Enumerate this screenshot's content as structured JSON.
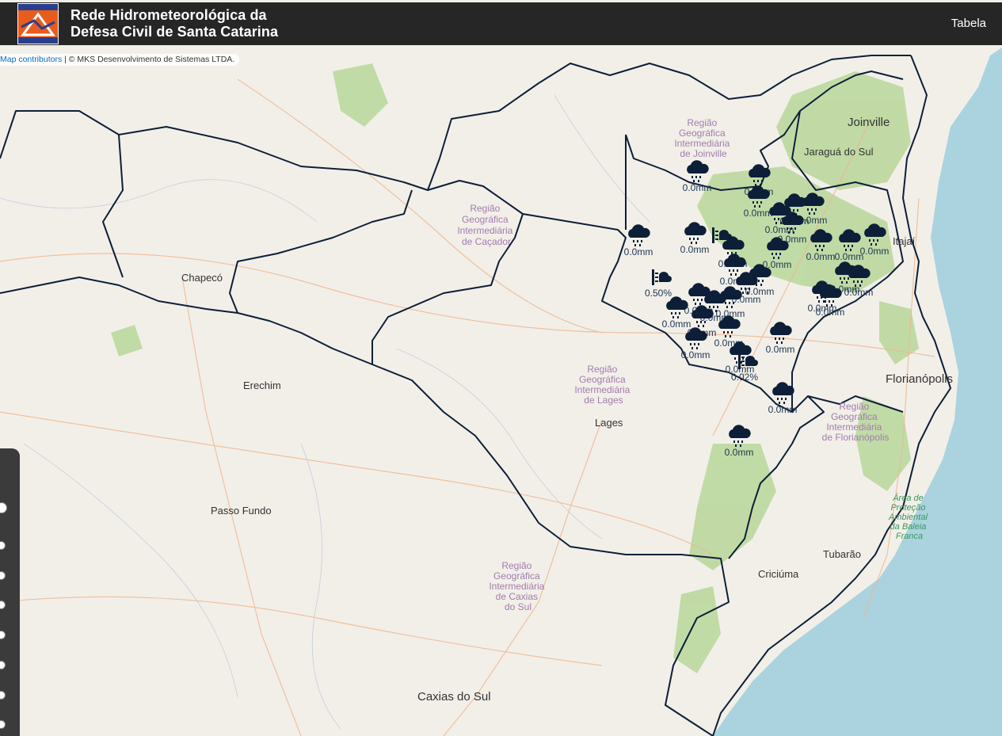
{
  "header": {
    "title_line1": "Rede Hidrometeorológica da",
    "title_line2": "Defesa Civil de Santa Catarina",
    "logo_text": "SANTA CATARINA",
    "table_link": "Tabela"
  },
  "attribution": {
    "link": "Map contributors",
    "text": " | © MKS Desenvolvimento de Sistemas LTDA."
  },
  "colors": {
    "topbar": "#262626",
    "border": "#0d1f38",
    "marker": "#0d1f38",
    "ocean": "#aad3df",
    "land": "#f2efe9",
    "forest": "#b9d79a"
  },
  "places": [
    {
      "name": "Joinville"
    },
    {
      "name": "Jaraguá do Sul"
    },
    {
      "name": "Chapecó"
    },
    {
      "name": "Erechim"
    },
    {
      "name": "Lages"
    },
    {
      "name": "Florianópolis"
    },
    {
      "name": "Passo Fundo"
    },
    {
      "name": "Tubarão"
    },
    {
      "name": "Criciúma"
    },
    {
      "name": "Caxias do Sul"
    },
    {
      "name": "Itajaí"
    }
  ],
  "regions": [
    {
      "lines": [
        "Região",
        "Geográfica",
        "Intermediária",
        "de Joinville"
      ]
    },
    {
      "lines": [
        "Região",
        "Geográfica",
        "Intermediária",
        "de Caçador"
      ]
    },
    {
      "lines": [
        "Região",
        "Geográfica",
        "Intermediária",
        "de Lages"
      ]
    },
    {
      "lines": [
        "Região",
        "Geográfica",
        "Intermediária",
        "de Florianópolis"
      ]
    },
    {
      "lines": [
        "Região",
        "Geográfica",
        "Intermediária",
        "de Caxias",
        "do Sul"
      ]
    },
    {
      "lines": [
        "Área de",
        "Proteção",
        "Ambiental",
        "da Baleia",
        "Franca"
      ]
    }
  ],
  "stations": [
    {
      "type": "rain",
      "value": "0.0mm"
    },
    {
      "type": "rain",
      "value": "0.0mm"
    },
    {
      "type": "rain",
      "value": "0.0mm"
    },
    {
      "type": "rain",
      "value": "0.0mm"
    },
    {
      "type": "rain",
      "value": "0.0mm"
    },
    {
      "type": "rain",
      "value": "0.0mm"
    },
    {
      "type": "rain",
      "value": "0.0mm"
    },
    {
      "type": "rain",
      "value": "0.0mm"
    },
    {
      "type": "rain",
      "value": "0.0mm"
    },
    {
      "type": "rain",
      "value": "0.0mm"
    },
    {
      "type": "rain",
      "value": "0.0mm"
    },
    {
      "type": "rain",
      "value": "0.0mm"
    },
    {
      "type": "rain",
      "value": "0.0mm"
    },
    {
      "type": "rain",
      "value": "0.0mm"
    },
    {
      "type": "rain",
      "value": "0.0mm"
    },
    {
      "type": "rain",
      "value": "0.0mm"
    },
    {
      "type": "rain",
      "value": "0.0mm"
    },
    {
      "type": "rain",
      "value": "0.0mm"
    },
    {
      "type": "rain",
      "value": "0.0mm"
    },
    {
      "type": "rain",
      "value": "0.0mm"
    },
    {
      "type": "rain",
      "value": "0.0mm"
    },
    {
      "type": "rain",
      "value": "0.0mm"
    },
    {
      "type": "rain",
      "value": "0.0mm"
    },
    {
      "type": "rain",
      "value": "0.0mm"
    },
    {
      "type": "rain",
      "value": "0.0mm"
    },
    {
      "type": "rain",
      "value": "0.0mm"
    },
    {
      "type": "rain",
      "value": "0.0mm"
    },
    {
      "type": "rain",
      "value": "0.0mm"
    },
    {
      "type": "rain",
      "value": "0.0mm"
    },
    {
      "type": "rain",
      "value": "0.0mm"
    },
    {
      "type": "rain",
      "value": "0.0mm"
    },
    {
      "type": "rain",
      "value": "0.0mm"
    },
    {
      "type": "level",
      "value": "0.50%"
    },
    {
      "type": "level",
      "value": "0.02%"
    },
    {
      "type": "level",
      "value": ""
    }
  ]
}
